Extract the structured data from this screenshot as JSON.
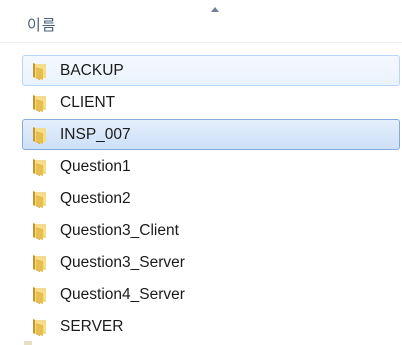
{
  "header": {
    "column_name": "이름"
  },
  "files": [
    {
      "name": "BACKUP",
      "type": "folder",
      "state": "hover"
    },
    {
      "name": "CLIENT",
      "type": "folder",
      "state": "normal"
    },
    {
      "name": "INSP_007",
      "type": "folder",
      "state": "selected"
    },
    {
      "name": "Question1",
      "type": "folder",
      "state": "normal"
    },
    {
      "name": "Question2",
      "type": "folder",
      "state": "normal"
    },
    {
      "name": "Question3_Client",
      "type": "folder",
      "state": "normal"
    },
    {
      "name": "Question3_Server",
      "type": "folder",
      "state": "normal"
    },
    {
      "name": "Question4_Server",
      "type": "folder",
      "state": "normal"
    },
    {
      "name": "SERVER",
      "type": "folder",
      "state": "normal"
    }
  ],
  "colors": {
    "folder_body": "#e8c45a",
    "folder_back": "#d9a93a",
    "hover_border": "#b8d6fb",
    "selected_border": "#84acdd"
  }
}
